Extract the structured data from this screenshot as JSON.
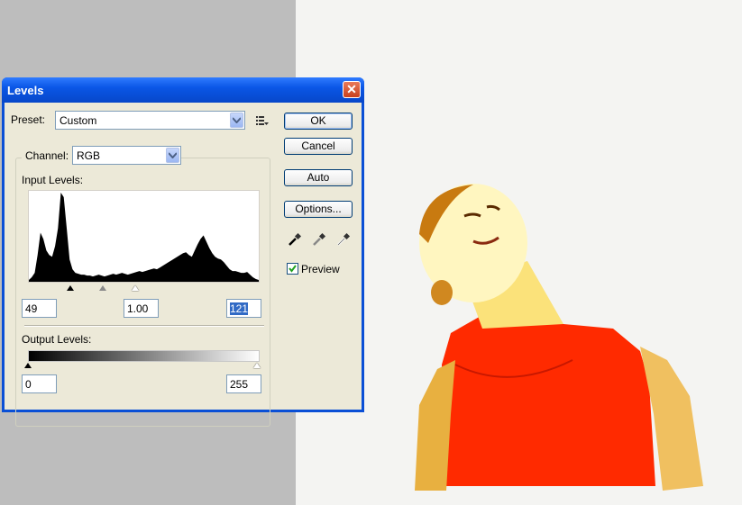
{
  "dialog": {
    "title": "Levels",
    "close_label": "✕",
    "preset": {
      "label": "Preset:",
      "value": "Custom"
    },
    "channel": {
      "label": "Channel:",
      "value": "RGB"
    },
    "input_levels": {
      "label": "Input Levels:",
      "black": "49",
      "gamma": "1.00",
      "white": "121"
    },
    "output_levels": {
      "label": "Output Levels:",
      "black": "0",
      "white": "255"
    },
    "buttons": {
      "ok": "OK",
      "cancel": "Cancel",
      "auto": "Auto",
      "options": "Options..."
    },
    "preview": {
      "label": "Preview",
      "checked": true
    },
    "histogram": [
      2,
      5,
      10,
      30,
      55,
      48,
      35,
      30,
      28,
      40,
      60,
      100,
      95,
      60,
      25,
      14,
      10,
      9,
      8,
      8,
      7,
      7,
      6,
      7,
      8,
      7,
      6,
      7,
      8,
      9,
      8,
      9,
      10,
      9,
      8,
      9,
      10,
      11,
      12,
      11,
      12,
      13,
      14,
      15,
      14,
      16,
      18,
      20,
      22,
      24,
      26,
      28,
      30,
      32,
      33,
      30,
      28,
      35,
      42,
      48,
      52,
      45,
      38,
      32,
      28,
      26,
      25,
      22,
      18,
      14,
      12,
      12,
      11,
      10,
      10,
      11,
      8,
      5,
      3,
      2
    ]
  },
  "colors": {
    "accent": "#0a4fd6",
    "dialog_bg": "#ece9d8",
    "photo_shirt": "#ff2a00"
  }
}
